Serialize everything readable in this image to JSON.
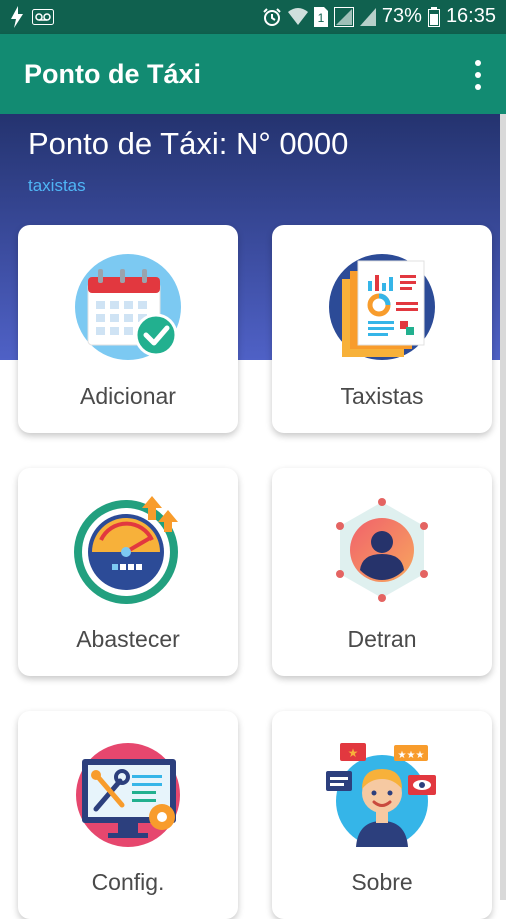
{
  "status_bar": {
    "battery_percent": "73%",
    "time": "16:35",
    "icons": [
      "flash-icon",
      "voicemail-icon",
      "alarm-icon",
      "wifi-icon",
      "sim-1-icon",
      "signal-icon",
      "battery-icon"
    ]
  },
  "app_bar": {
    "title": "Ponto de Táxi",
    "menu_icon": "more-vertical-icon"
  },
  "hero": {
    "heading": "Ponto de Táxi: N° 0000",
    "subheading": "taxistas"
  },
  "colors": {
    "status_bar": "#10614f",
    "app_bar": "#128b72",
    "hero_top": "#24336f",
    "hero_bottom": "#4f61c6",
    "subheading": "#4fb6f6"
  },
  "cards": [
    {
      "label": "Adicionar",
      "icon": "calendar-check-icon"
    },
    {
      "label": "Taxistas",
      "icon": "report-document-icon"
    },
    {
      "label": "Abastecer",
      "icon": "fuel-gauge-icon"
    },
    {
      "label": "Detran",
      "icon": "user-profile-icon"
    },
    {
      "label": "Config.",
      "icon": "monitor-settings-icon"
    },
    {
      "label": "Sobre",
      "icon": "person-feedback-icon"
    }
  ]
}
